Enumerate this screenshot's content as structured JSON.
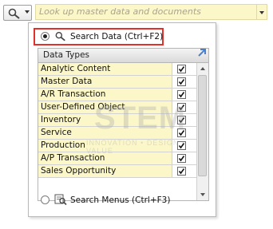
{
  "search": {
    "placeholder": "Look up master data and documents",
    "button_icon": "search-icon"
  },
  "popup": {
    "search_data": {
      "label": "Search Data (Ctrl+F2)",
      "selected": true
    },
    "search_menus": {
      "label": "Search Menus (Ctrl+F3)",
      "selected": false
    },
    "table": {
      "header": "Data Types",
      "rows": [
        {
          "label": "Analytic Content",
          "checked": true
        },
        {
          "label": "Master Data",
          "checked": true
        },
        {
          "label": "A/R Transaction",
          "checked": true
        },
        {
          "label": "User-Defined Object",
          "checked": true
        },
        {
          "label": "Inventory",
          "checked": true
        },
        {
          "label": "Service",
          "checked": true
        },
        {
          "label": "Production",
          "checked": true
        },
        {
          "label": "A/P Transaction",
          "checked": true
        },
        {
          "label": "Sales Opportunity",
          "checked": true
        }
      ]
    },
    "watermark": {
      "main": "STEM",
      "sub": "INNOVATION • DESIGN • VALUE"
    }
  },
  "colors": {
    "input_bg": "#fbf7c8",
    "highlight": "#e0312a",
    "expand_icon": "#4a7fd0"
  }
}
